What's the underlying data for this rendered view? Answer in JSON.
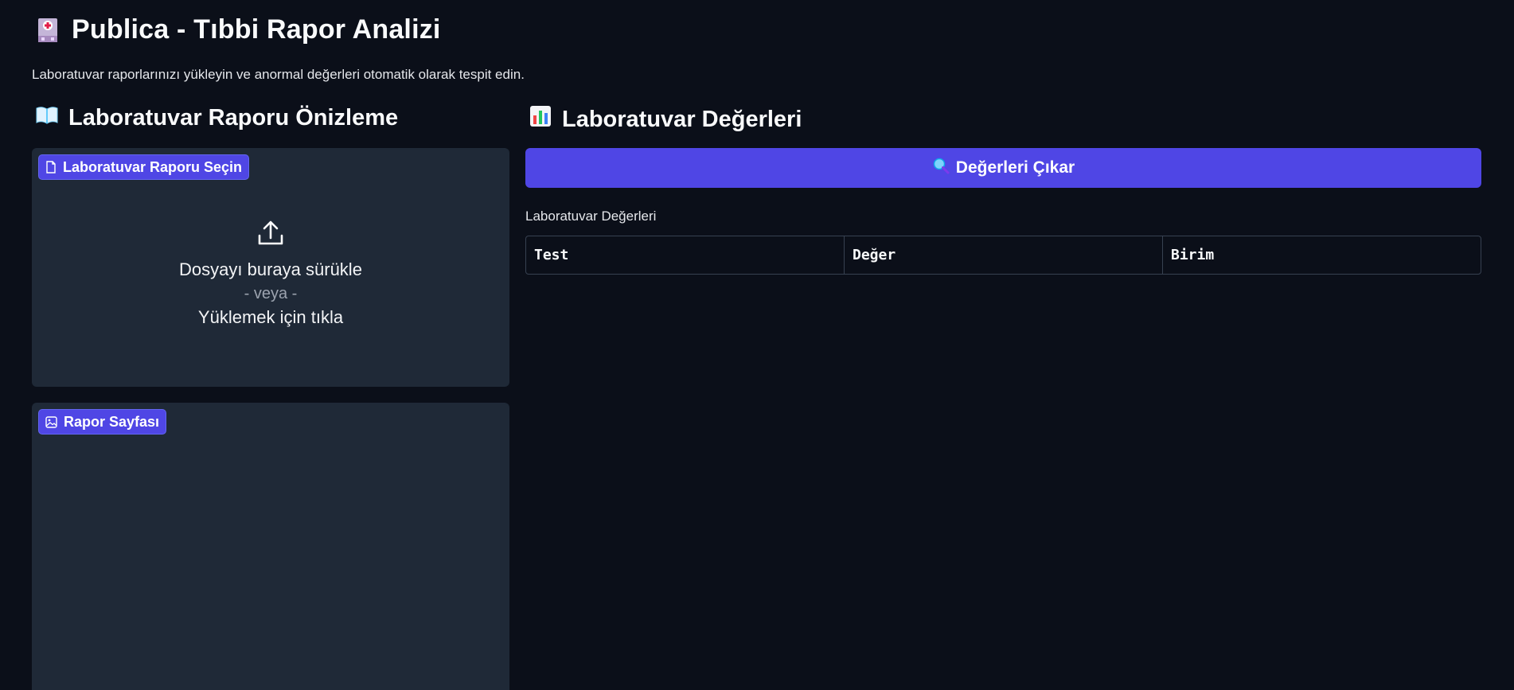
{
  "header": {
    "title": "Publica - Tıbbi Rapor Analizi",
    "icon": "hospital-icon",
    "subtitle": "Laboratuvar raporlarınızı yükleyin ve anormal değerleri otomatik olarak tespit edin."
  },
  "left": {
    "section_title": "Laboratuvar Raporu Önizleme",
    "section_icon": "open-book-icon",
    "upload": {
      "label": "Laboratuvar Raporu Seçin",
      "drop_text": "Dosyayı buraya sürükle",
      "or_text": "- veya -",
      "click_text": "Yüklemek için tıkla"
    },
    "image_panel": {
      "label": "Rapor Sayfası"
    }
  },
  "right": {
    "section_title": "Laboratuvar Değerleri",
    "section_icon": "bar-chart-icon",
    "extract_button": "Değerleri Çıkar",
    "extract_icon": "magnifier-icon",
    "table_label": "Laboratuvar Değerleri",
    "columns": [
      "Test",
      "Değer",
      "Birim"
    ]
  },
  "colors": {
    "background": "#0b0f19",
    "panel": "#1f2937",
    "accent": "#4f46e5"
  }
}
